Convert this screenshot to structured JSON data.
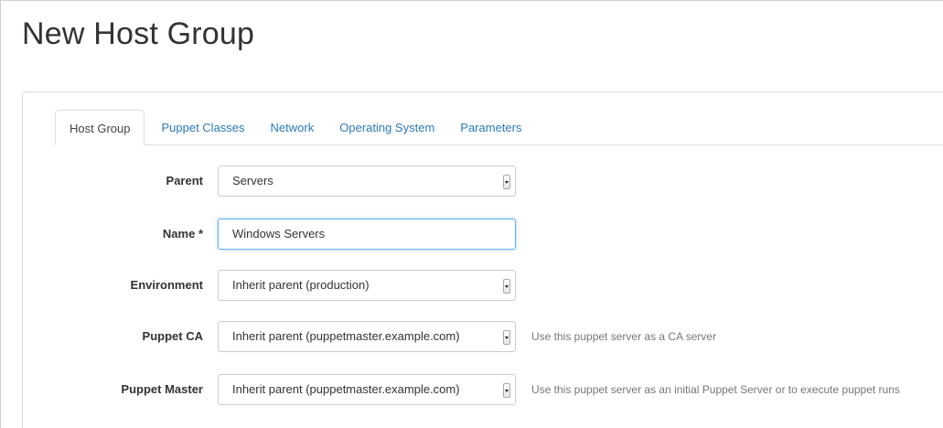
{
  "page": {
    "title": "New Host Group"
  },
  "tabs": [
    {
      "label": "Host Group",
      "active": true
    },
    {
      "label": "Puppet Classes",
      "active": false
    },
    {
      "label": "Network",
      "active": false
    },
    {
      "label": "Operating System",
      "active": false
    },
    {
      "label": "Parameters",
      "active": false
    }
  ],
  "form": {
    "parent": {
      "label": "Parent",
      "value": "Servers"
    },
    "name": {
      "label": "Name *",
      "value": "Windows Servers"
    },
    "environment": {
      "label": "Environment",
      "value": "Inherit parent (production)"
    },
    "puppet_ca": {
      "label": "Puppet CA",
      "value": "Inherit parent (puppetmaster.example.com)",
      "help": "Use this puppet server as a CA server"
    },
    "puppet_master": {
      "label": "Puppet Master",
      "value": "Inherit parent (puppetmaster.example.com)",
      "help": "Use this puppet server as an initial Puppet Server or to execute puppet runs"
    }
  },
  "colors": {
    "link": "#2a7ab8",
    "focus_border": "#66afe9"
  }
}
